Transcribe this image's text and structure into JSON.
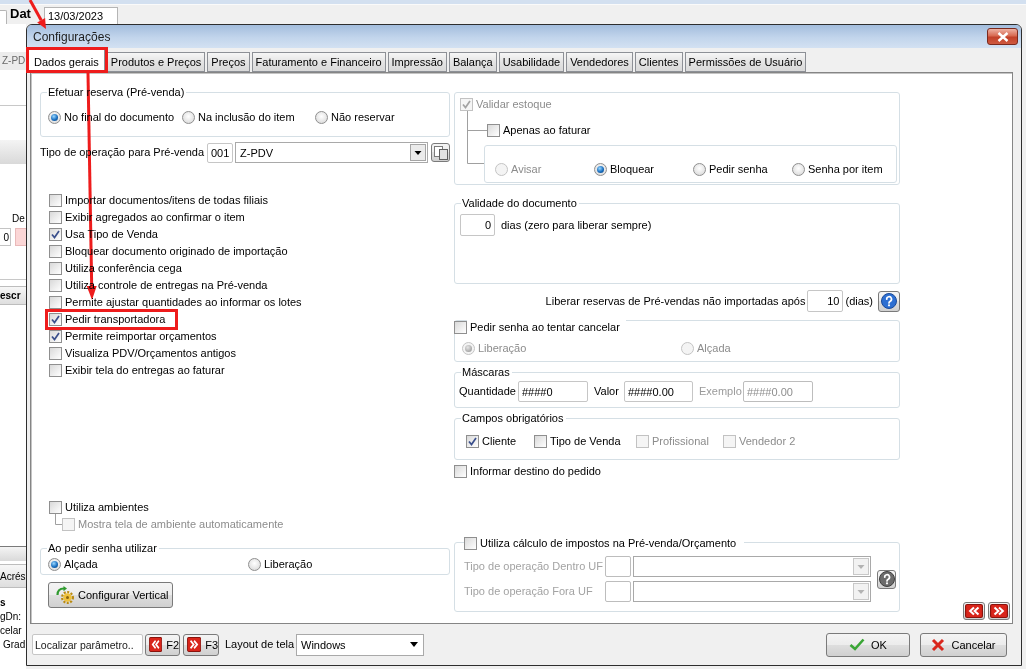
{
  "background_window": {
    "date_label": "Dat",
    "date_field": "13/03/2023",
    "field_1": "Z-PD",
    "label_1": "De",
    "field_2": "0",
    "header_1": "escr",
    "header_2": "Acrés",
    "lines": [
      "s",
      "gDn:",
      "celar",
      "Grad"
    ]
  },
  "dialog": {
    "title": "Configurações",
    "tabs": [
      {
        "label": "Dados gerais",
        "selected": true
      },
      {
        "label": "Produtos e Preços",
        "selected": false
      },
      {
        "label": "Preços",
        "selected": false
      },
      {
        "label": "Faturamento e Financeiro",
        "selected": false
      },
      {
        "label": "Impressão",
        "selected": false
      },
      {
        "label": "Balança",
        "selected": false
      },
      {
        "label": "Usabilidade",
        "selected": false
      },
      {
        "label": "Vendedores",
        "selected": false
      },
      {
        "label": "Clientes",
        "selected": false
      },
      {
        "label": "Permissões de Usuário",
        "selected": false
      }
    ],
    "reserve": {
      "title": "Efetuar reserva (Pré-venda)",
      "options": [
        {
          "label": "No final do documento",
          "selected": true
        },
        {
          "label": "Na inclusão do item",
          "selected": false
        },
        {
          "label": "Não reservar",
          "selected": false
        }
      ]
    },
    "operation": {
      "label": "Tipo de operação para Pré-venda",
      "code": "001",
      "value": "Z-PDV"
    },
    "options": [
      {
        "label": "Importar documentos/itens de todas filiais",
        "checked": false
      },
      {
        "label": "Exibir agregados ao confirmar o item",
        "checked": false
      },
      {
        "label": "Usa Tipo de Venda",
        "checked": true
      },
      {
        "label": "Bloquear documento originado de importação",
        "checked": false
      },
      {
        "label": "Utiliza conferência cega",
        "checked": false
      },
      {
        "label": "Utiliza controle de entregas na Pré-venda",
        "checked": false
      },
      {
        "label": "Permite ajustar quantidades ao informar os lotes",
        "checked": false
      },
      {
        "label": "Pedir transportadora",
        "checked": true
      },
      {
        "label": "Permite reimportar orçamentos",
        "checked": true
      },
      {
        "label": "Visualiza PDV/Orçamentos antigos",
        "checked": false
      },
      {
        "label": "Exibir tela do entregas ao faturar",
        "checked": false
      }
    ],
    "environments": {
      "label": "Utiliza ambientes",
      "checked": false,
      "sub": {
        "label": "Mostra tela de ambiente automaticamente",
        "checked": false,
        "disabled": true
      }
    },
    "password_mode": {
      "title": "Ao pedir senha utilizar",
      "options": [
        {
          "label": "Alçada",
          "selected": true
        },
        {
          "label": "Liberação",
          "selected": false
        }
      ]
    },
    "vertical_button": "Configurar Vertical",
    "stock": {
      "validate": {
        "label": "Validar estoque",
        "checked": true,
        "disabled": true
      },
      "only_on_invoice": {
        "label": "Apenas ao faturar",
        "checked": false
      },
      "actions": [
        {
          "label": "Avisar",
          "selected": false,
          "disabled": true
        },
        {
          "label": "Bloquear",
          "selected": true,
          "disabled": false
        },
        {
          "label": "Pedir senha",
          "selected": false,
          "disabled": false
        },
        {
          "label": "Senha por item",
          "selected": false,
          "disabled": false
        }
      ]
    },
    "validity": {
      "title": "Validade do documento",
      "days": "0",
      "note": "dias (zero para liberar sempre)"
    },
    "release": {
      "label": "Liberar reservas de Pré-vendas não importadas após",
      "days": "10",
      "unit": "(dias)"
    },
    "cancel_password": {
      "label": "Pedir senha ao tentar cancelar",
      "checked": false,
      "options": [
        {
          "label": "Liberação",
          "selected": true,
          "disabled": true
        },
        {
          "label": "Alçada",
          "selected": false,
          "disabled": true
        }
      ]
    },
    "masks": {
      "title": "Máscaras",
      "fields": [
        {
          "label": "Quantidade",
          "value": "####0",
          "disabled": false
        },
        {
          "label": "Valor",
          "value": "####0.00",
          "disabled": false
        },
        {
          "label": "Exemplo",
          "value": "####0.00",
          "disabled": true
        }
      ]
    },
    "required_fields": {
      "title": "Campos obrigatórios",
      "items": [
        {
          "label": "Cliente",
          "checked": true,
          "disabled": false
        },
        {
          "label": "Tipo de Venda",
          "checked": false,
          "disabled": false
        },
        {
          "label": "Profissional",
          "checked": false,
          "disabled": true
        },
        {
          "label": "Vendedor 2",
          "checked": false,
          "disabled": true
        }
      ]
    },
    "destination": {
      "label": "Informar destino do pedido",
      "checked": false
    },
    "taxes": {
      "label": "Utiliza cálculo de impostos na Pré-venda/Orçamento",
      "checked": false,
      "rows": [
        {
          "label": "Tipo de operação Dentro UF",
          "disabled": true
        },
        {
          "label": "Tipo de operação Fora UF",
          "disabled": true
        }
      ]
    },
    "footer": {
      "search_placeholder": "Localizar parâmetro..",
      "previous_key": "F2",
      "next_key": "F3",
      "layout_label": "Layout de tela",
      "layout_value": "Windows",
      "ok": "OK",
      "cancel": "Cancelar"
    }
  }
}
